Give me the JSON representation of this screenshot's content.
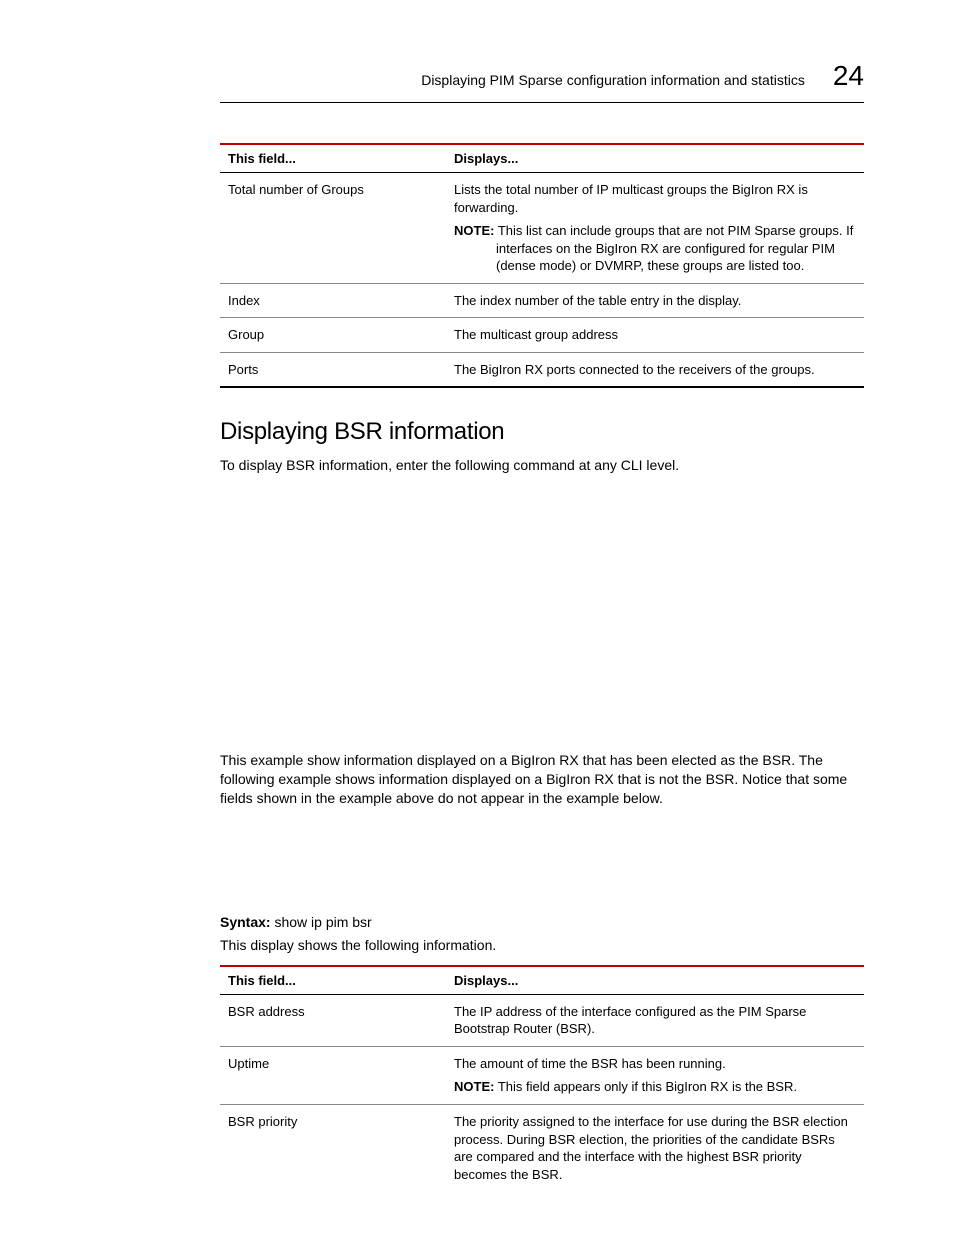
{
  "header": {
    "running_title": "Displaying PIM Sparse configuration information and statistics",
    "chapter_number": "24"
  },
  "table1": {
    "head_col1": "This field...",
    "head_col2": "Displays...",
    "rows": [
      {
        "field": "Total number of Groups",
        "desc": "Lists the total number of IP multicast groups the BigIron RX is forwarding.",
        "note_label": "NOTE:",
        "note": "This list can include groups that are not PIM Sparse groups. If interfaces on the BigIron RX are configured for regular PIM (dense mode) or DVMRP, these groups are listed too."
      },
      {
        "field": "Index",
        "desc": "The index number of the table entry in the display."
      },
      {
        "field": "Group",
        "desc": "The multicast group address"
      },
      {
        "field": "Ports",
        "desc": "The BigIron RX ports connected to the receivers of the groups."
      }
    ]
  },
  "section": {
    "heading": "Displaying BSR information",
    "intro": "To display BSR information, enter the following command at any CLI level.",
    "midtext": "This example show information displayed on a BigIron RX that has been elected as the BSR. The following example shows information displayed on a BigIron RX that is not the BSR. Notice that some fields shown in the example above do not appear in the example below.",
    "syntax_label": "Syntax:",
    "syntax_cmd": "show ip pim bsr",
    "postsyntax": "This display shows the following information."
  },
  "table2": {
    "head_col1": "This field...",
    "head_col2": "Displays...",
    "rows": [
      {
        "field": "BSR address",
        "desc": "The IP address of the interface configured as the PIM Sparse Bootstrap Router (BSR)."
      },
      {
        "field": "Uptime",
        "desc": "The amount of time the BSR has been running.",
        "note_label": "NOTE:",
        "note": "This field appears only if this BigIron RX is the BSR."
      },
      {
        "field": "BSR priority",
        "desc": "The priority assigned to the interface for use during the BSR election process. During BSR election, the priorities of the candidate BSRs are compared and the interface with the highest BSR priority becomes the BSR."
      }
    ]
  }
}
